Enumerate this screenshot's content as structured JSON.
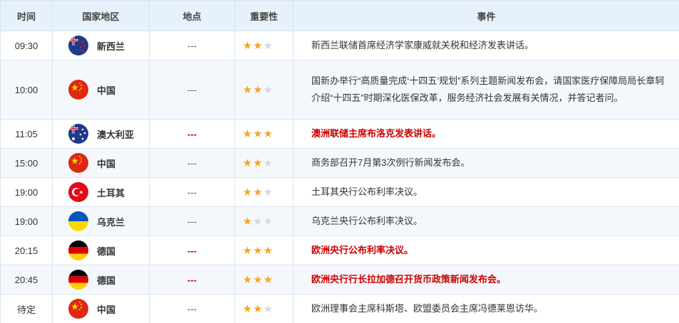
{
  "headers": {
    "time": "时间",
    "country": "国家地区",
    "location": "地点",
    "importance": "重要性",
    "event": "事件"
  },
  "colors": {
    "header_bg": "#e7f1fb",
    "border": "#d9e4ef",
    "highlight": "#cc0000",
    "star_on": "#f5a623",
    "star_off": "#d8d8d8"
  },
  "rows": [
    {
      "time": "09:30",
      "flag": "nz",
      "country": "新西兰",
      "location": "---",
      "stars": 2,
      "highlight": false,
      "event": "新西兰联储首席经济学家康威就关税和经济发表讲话。"
    },
    {
      "time": "10:00",
      "flag": "cn",
      "country": "中国",
      "location": "---",
      "stars": 2,
      "highlight": false,
      "event": "国新办举行“高质量完成‘十四五’规划”系列主题新闻发布会，请国家医疗保障局局长章轲介绍“十四五”时期深化医保改革，服务经济社会发展有关情况，并答记者问。"
    },
    {
      "time": "11:05",
      "flag": "au",
      "country": "澳大利亚",
      "location": "---",
      "stars": 3,
      "highlight": true,
      "event": "澳洲联储主席布洛克发表讲话。"
    },
    {
      "time": "15:00",
      "flag": "cn",
      "country": "中国",
      "location": "---",
      "stars": 2,
      "highlight": false,
      "event": "商务部召开7月第3次例行新闻发布会。"
    },
    {
      "time": "19:00",
      "flag": "tr",
      "country": "土耳其",
      "location": "---",
      "stars": 2,
      "highlight": false,
      "event": "土耳其央行公布利率决议。"
    },
    {
      "time": "19:00",
      "flag": "ua",
      "country": "乌克兰",
      "location": "---",
      "stars": 1,
      "highlight": false,
      "event": "乌克兰央行公布利率决议。"
    },
    {
      "time": "20:15",
      "flag": "de",
      "country": "德国",
      "location": "---",
      "stars": 3,
      "highlight": true,
      "event": "欧洲央行公布利率决议。"
    },
    {
      "time": "20:45",
      "flag": "de",
      "country": "德国",
      "location": "---",
      "stars": 3,
      "highlight": true,
      "event": "欧洲央行行长拉加德召开货币政策新闻发布会。"
    },
    {
      "time": "待定",
      "flag": "cn",
      "country": "中国",
      "location": "---",
      "stars": 2,
      "highlight": false,
      "event": "欧洲理事会主席科斯塔、欧盟委员会主席冯德莱恩访华。"
    }
  ]
}
